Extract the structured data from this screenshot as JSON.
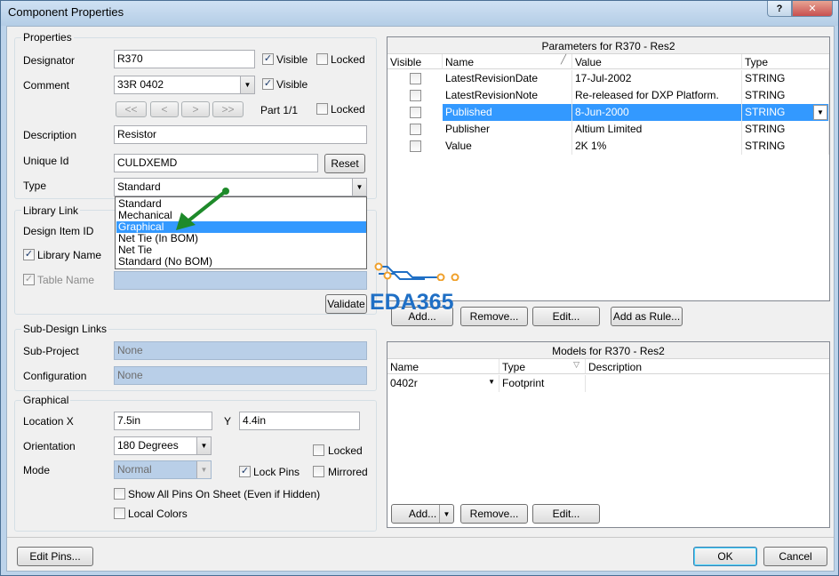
{
  "window": {
    "title": "Component Properties",
    "help_glyph": "?",
    "close_glyph": "✕"
  },
  "properties": {
    "group_label": "Properties",
    "designator_label": "Designator",
    "designator_value": "R370",
    "designator_visible_label": "Visible",
    "designator_locked_label": "Locked",
    "comment_label": "Comment",
    "comment_value": "33R 0402",
    "comment_visible_label": "Visible",
    "part_nav": [
      "<<",
      "<",
      ">",
      ">>"
    ],
    "part_text": "Part 1/1",
    "part_locked_label": "Locked",
    "description_label": "Description",
    "description_value": "Resistor",
    "unique_id_label": "Unique Id",
    "unique_id_value": "CULDXEMD",
    "reset_label": "Reset",
    "type_label": "Type",
    "type_value": "Standard",
    "type_options": [
      "Standard",
      "Mechanical",
      "Graphical",
      "Net Tie (In BOM)",
      "Net Tie",
      "Standard (No BOM)"
    ],
    "type_selected_index": 2
  },
  "library_link": {
    "group_label": "Library Link",
    "design_item_label": "Design Item ID",
    "library_name_label": "Library Name",
    "table_name_label": "Table Name",
    "validate_label": "Validate"
  },
  "sub_design": {
    "group_label": "Sub-Design Links",
    "sub_project_label": "Sub-Project",
    "sub_project_value": "None",
    "configuration_label": "Configuration",
    "configuration_value": "None"
  },
  "graphical": {
    "group_label": "Graphical",
    "location_label": "Location X",
    "x_value": "7.5in",
    "y_label": "Y",
    "y_value": "4.4in",
    "orientation_label": "Orientation",
    "orientation_value": "180 Degrees",
    "locked_label": "Locked",
    "mode_label": "Mode",
    "mode_value": "Normal",
    "lock_pins_label": "Lock Pins",
    "mirrored_label": "Mirrored",
    "show_all_pins_label": "Show All Pins On Sheet (Even if Hidden)",
    "local_colors_label": "Local Colors"
  },
  "parameters": {
    "title": "Parameters for R370 - Res2",
    "columns": [
      "Visible",
      "Name",
      "Value",
      "Type"
    ],
    "rows": [
      {
        "name": "LatestRevisionDate",
        "value": "17-Jul-2002",
        "type": "STRING"
      },
      {
        "name": "LatestRevisionNote",
        "value": "Re-released for DXP Platform.",
        "type": "STRING"
      },
      {
        "name": "Published",
        "value": "8-Jun-2000",
        "type": "STRING"
      },
      {
        "name": "Publisher",
        "value": "Altium Limited",
        "type": "STRING"
      },
      {
        "name": "Value",
        "value": "2K 1%",
        "type": "STRING"
      }
    ],
    "selected_row": 2,
    "buttons": [
      "Add...",
      "Remove...",
      "Edit...",
      "Add as Rule..."
    ]
  },
  "models": {
    "title": "Models for R370 - Res2",
    "columns": [
      "Name",
      "Type",
      "Description"
    ],
    "rows": [
      {
        "name": "0402r",
        "type": "Footprint",
        "description": ""
      }
    ],
    "buttons": [
      "Add...",
      "Remove...",
      "Edit..."
    ]
  },
  "footer": {
    "edit_pins_label": "Edit Pins...",
    "ok_label": "OK",
    "cancel_label": "Cancel"
  },
  "watermark": "EDA365",
  "colors": {
    "selection": "#3399ff",
    "annotation_arrow": "#1e8a2a",
    "watermark_blue": "#1f6fc5",
    "watermark_orange": "#f0a02a"
  }
}
